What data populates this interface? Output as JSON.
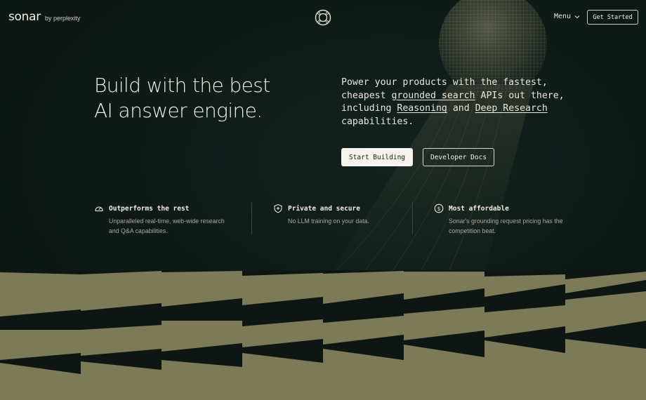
{
  "header": {
    "brand_name": "sonar",
    "brand_sub": "by perplexity",
    "menu_label": "Menu",
    "cta_label": "Get Started"
  },
  "hero": {
    "title_line1": "Build with the best",
    "title_line2": "AI answer engine.",
    "desc_part1": "Power your products with the fastest, cheapest ",
    "desc_link1": "grounded search",
    "desc_part2": " APIs out there, including ",
    "desc_link2": "Reasoning",
    "desc_part3": " and ",
    "desc_link3": "Deep Research",
    "desc_part4": " capabilities.",
    "primary_button": "Start Building",
    "secondary_button": "Developer Docs"
  },
  "features": [
    {
      "icon": "gauge-icon",
      "title": "Outperforms the rest",
      "text": "Unparalleled real-time, web-wide research and Q&A capabilities."
    },
    {
      "icon": "shield-plus-icon",
      "title": "Private and secure",
      "text": "No LLM training on your data."
    },
    {
      "icon": "dollar-circle-icon",
      "title": "Most affordable",
      "text": "Sonar's grounding request pricing has the competition beat."
    }
  ],
  "colors": {
    "background": "#0f1a17",
    "accent_olive": "#7d7a58",
    "text_light": "#f1efe6"
  }
}
